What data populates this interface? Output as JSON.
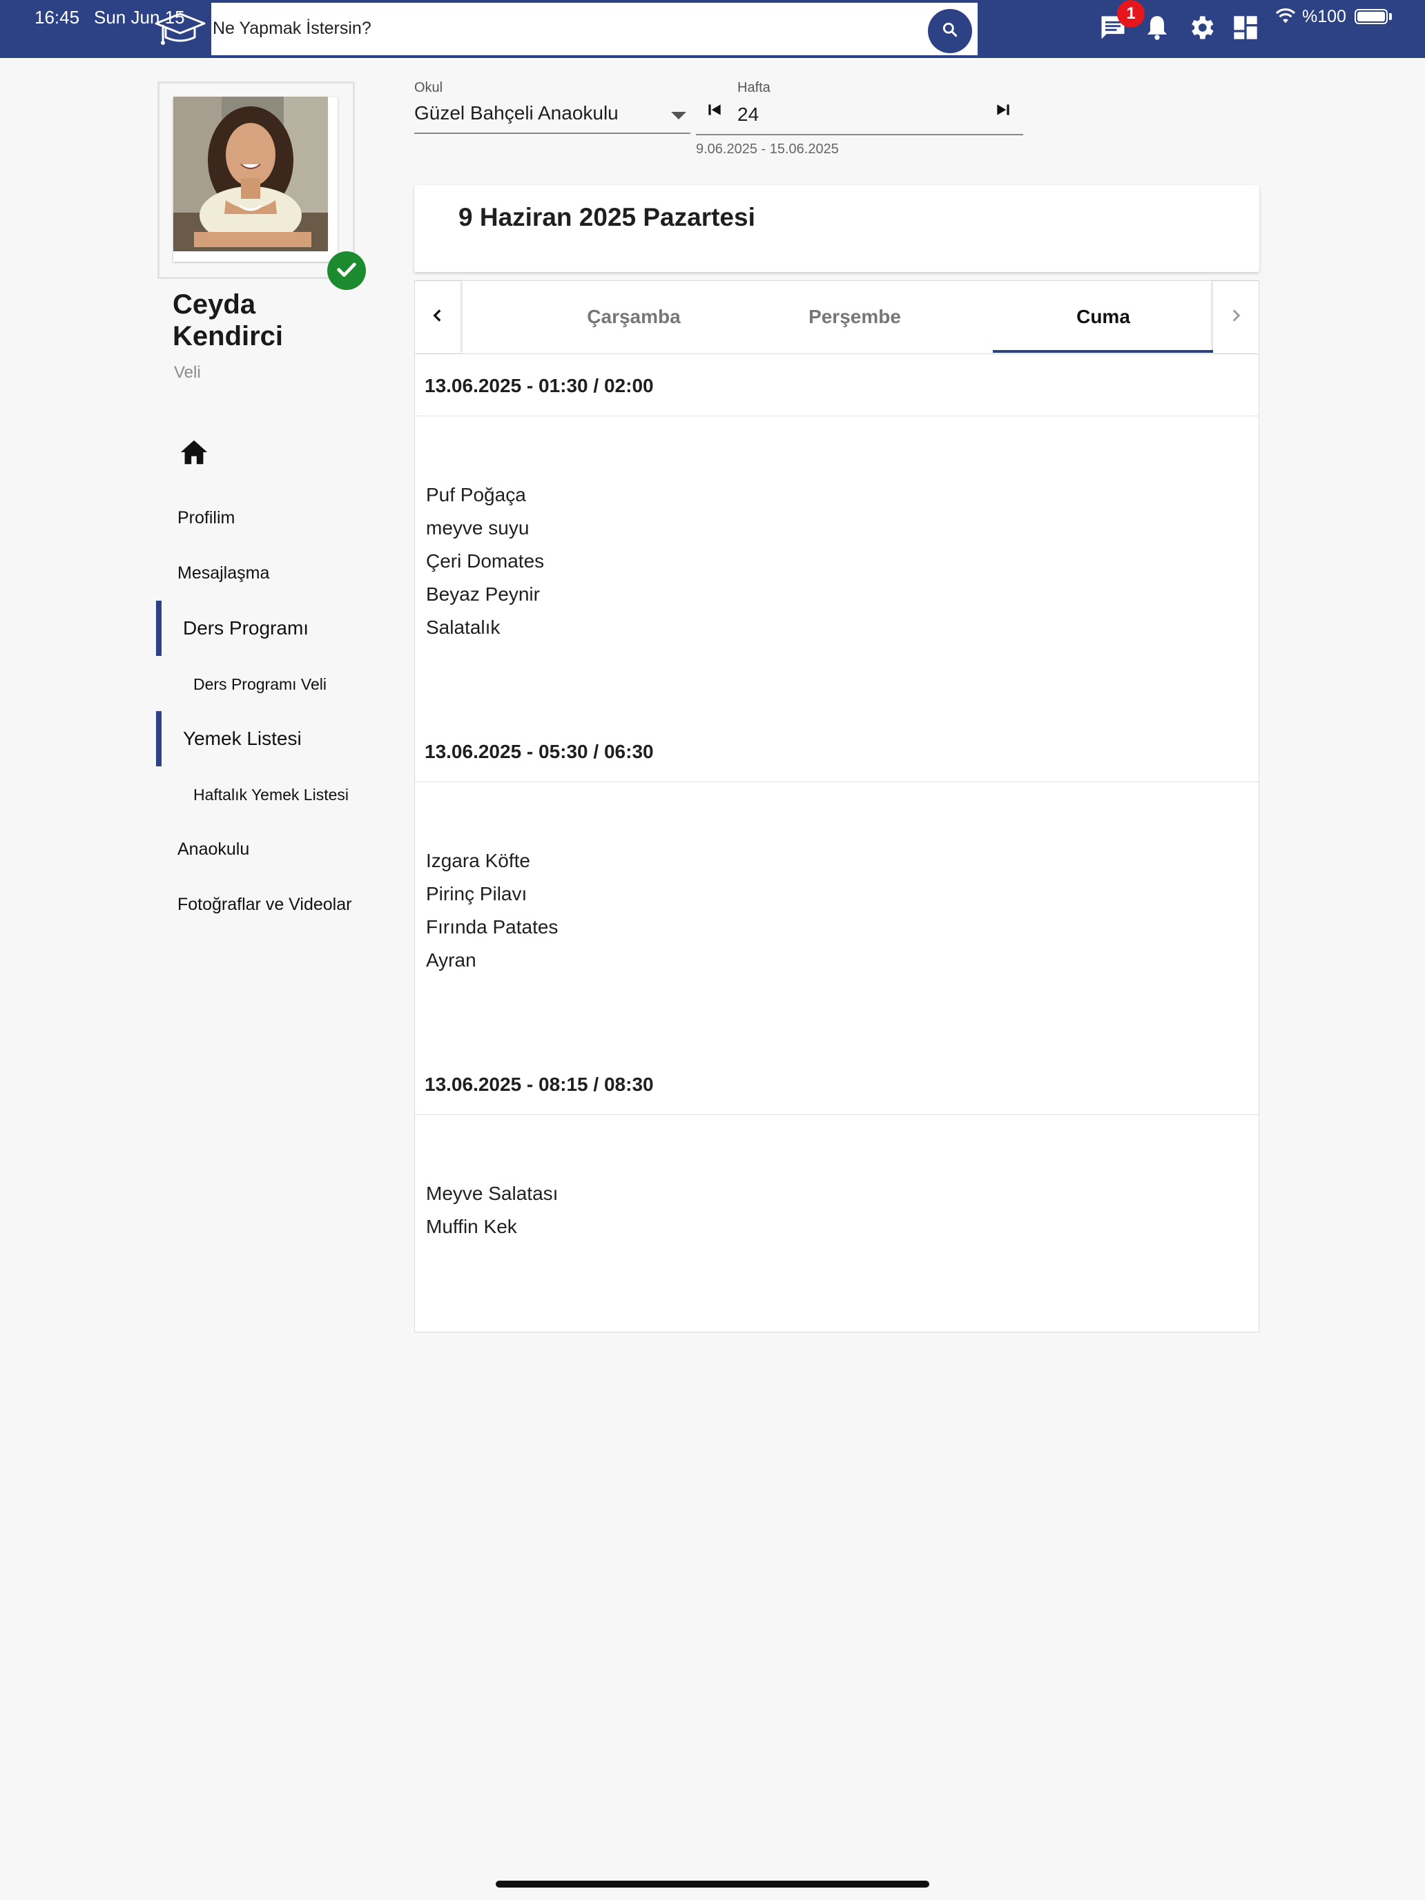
{
  "status_bar": {
    "time": "16:45",
    "date": "Sun Jun 15",
    "battery": "%100"
  },
  "search": {
    "placeholder": "Ne Yapmak İstersin?"
  },
  "notifications": {
    "message_count": "1"
  },
  "profile": {
    "name": "Ceyda Kendirci",
    "role": "Veli"
  },
  "nav": {
    "profile": "Profilim",
    "messaging": "Mesajlaşma",
    "lesson_program": "Ders Programı",
    "lesson_program_parent": "Ders Programı Veli",
    "meal_list": "Yemek Listesi",
    "weekly_meal_list": "Haftalık Yemek Listesi",
    "kindergarten": "Anaokulu",
    "photos_videos": "Fotoğraflar ve Videolar"
  },
  "filters": {
    "school_label": "Okul",
    "school_value": "Güzel Bahçeli Anaokulu",
    "week_label": "Hafta",
    "week_value": "24",
    "week_range": "9.06.2025 - 15.06.2025"
  },
  "date_card": {
    "title": "9 Haziran 2025 Pazartesi"
  },
  "tabs": [
    {
      "label": "Çarşamba"
    },
    {
      "label": "Perşembe"
    },
    {
      "label": "Cuma"
    }
  ],
  "active_tab": "Cuma",
  "meals": [
    {
      "time": "13.06.2025 - 01:30 / 02:00",
      "items": [
        "Puf Poğaça",
        "meyve suyu",
        "Çeri Domates",
        "Beyaz Peynir",
        "Salatalık"
      ]
    },
    {
      "time": "13.06.2025 - 05:30 / 06:30",
      "items": [
        "Izgara Köfte",
        "Pirinç Pilavı",
        "Fırında Patates",
        "Ayran"
      ]
    },
    {
      "time": "13.06.2025 - 08:15 / 08:30",
      "items": [
        "Meyve Salatası",
        "Muffin Kek"
      ]
    }
  ],
  "colors": {
    "primary": "#2d4285",
    "badge": "#e5161c",
    "verified": "#1c8a2e"
  },
  "icons": [
    "graduation-cap-icon",
    "search-icon",
    "chat-icon",
    "bell-icon",
    "gear-icon",
    "dashboard-icon",
    "wifi-icon",
    "home-icon",
    "check-icon",
    "chevron-left-icon",
    "chevron-right-icon",
    "skip-previous-icon",
    "skip-next-icon"
  ]
}
